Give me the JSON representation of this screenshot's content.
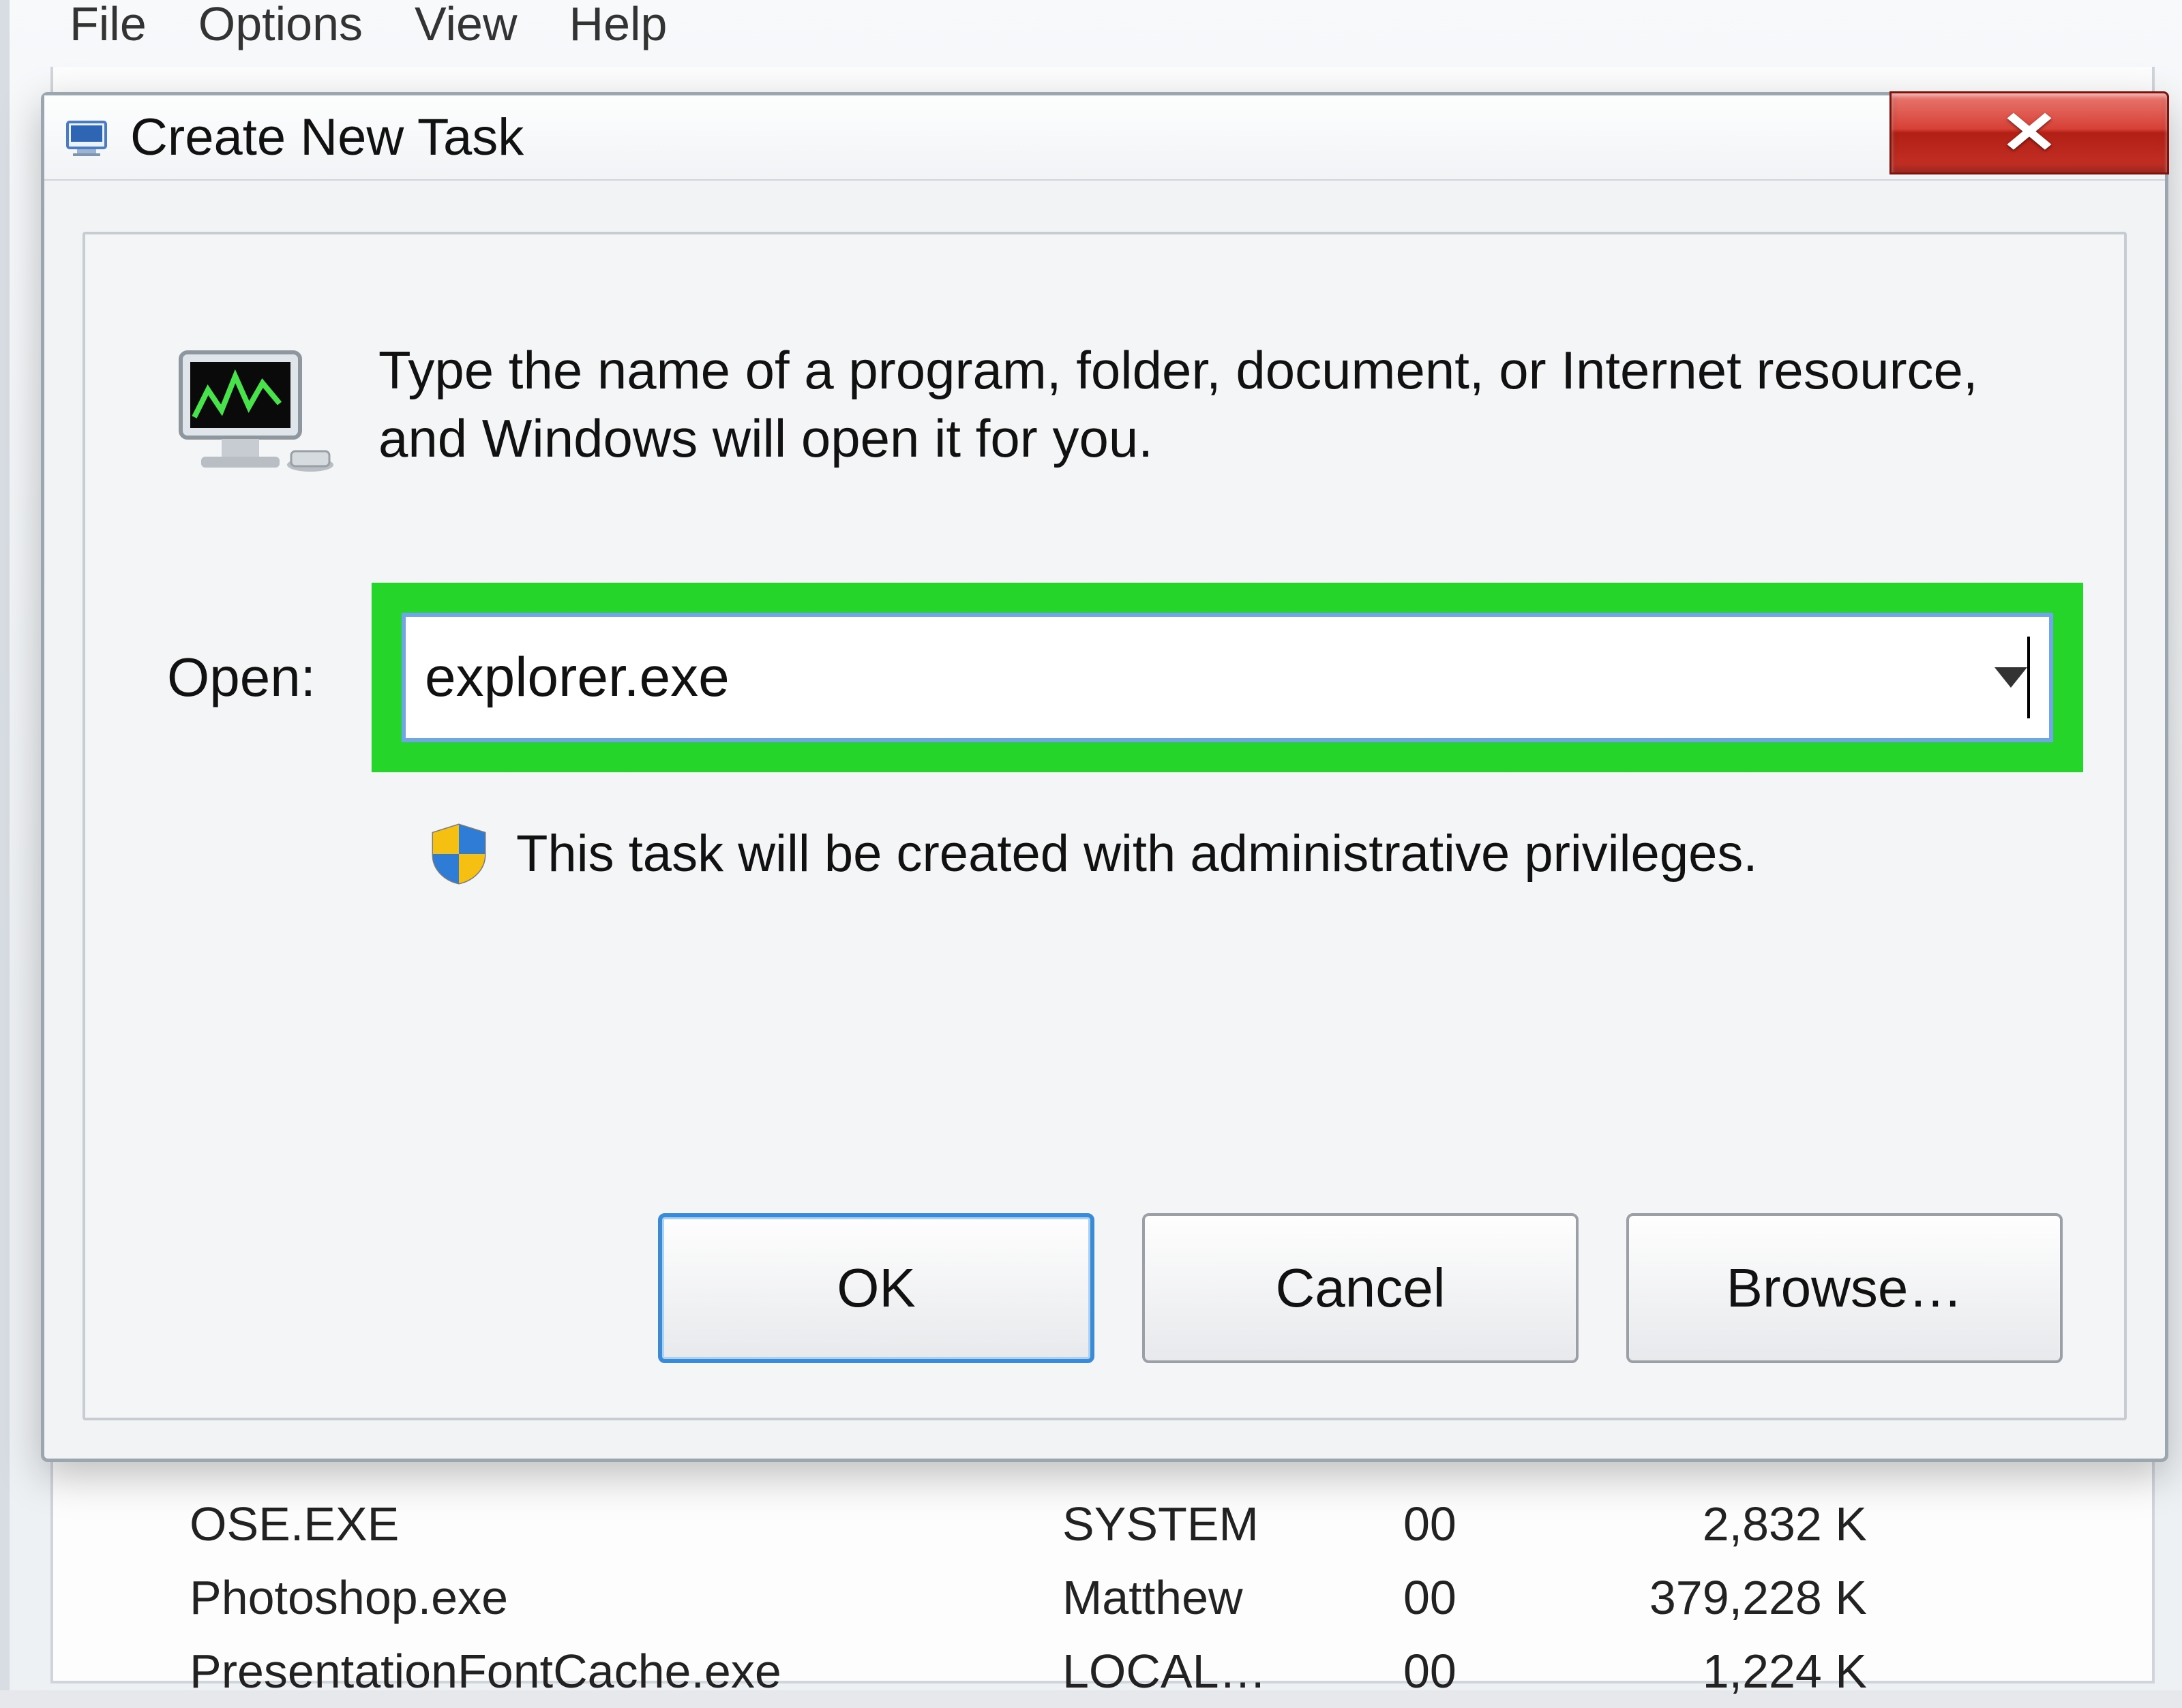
{
  "parent": {
    "menu": {
      "file": "File",
      "options": "Options",
      "view": "View",
      "help": "Help"
    },
    "rows": [
      {
        "name": "OSE.EXE",
        "user": "SYSTEM",
        "cpu": "00",
        "mem": "2,832 K"
      },
      {
        "name": "Photoshop.exe",
        "user": "Matthew",
        "cpu": "00",
        "mem": "379,228 K"
      },
      {
        "name": "PresentationFontCache.exe",
        "user": "LOCAL…",
        "cpu": "00",
        "mem": "1,224 K"
      }
    ]
  },
  "dialog": {
    "title": "Create New Task",
    "instruction": "Type the name of a program, folder, document, or Internet resource, and Windows will open it for you.",
    "open_label": "Open:",
    "open_value": "explorer.exe",
    "admin_note": "This task will be created with administrative privileges.",
    "buttons": {
      "ok": "OK",
      "cancel": "Cancel",
      "browse": "Browse…"
    }
  }
}
